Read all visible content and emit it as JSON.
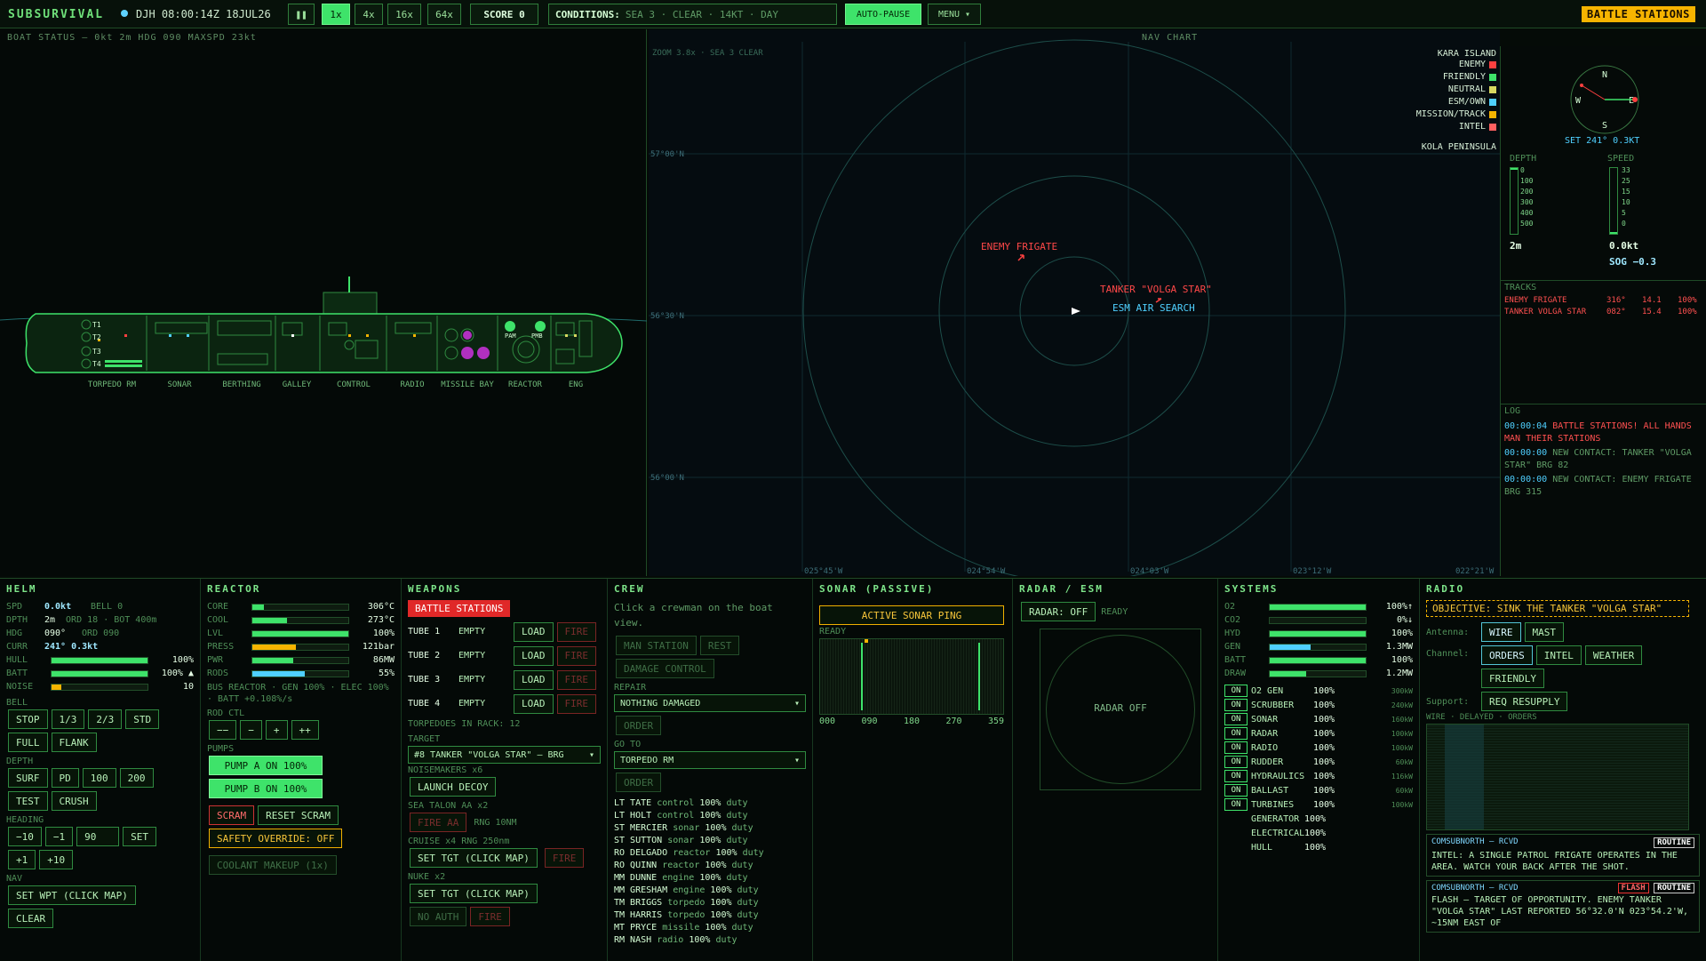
{
  "top": {
    "brand": "SUBSURVIVAL",
    "clock": "DJH 08:00:14Z 18JUL26",
    "pause": "❚❚",
    "speeds": [
      "1x",
      "4x",
      "16x",
      "64x"
    ],
    "score_label": "SCORE",
    "score": "0",
    "cond_label": "CONDITIONS:",
    "cond": "SEA 3 · CLEAR · 14KT · DAY",
    "autopause": "AUTO-PAUSE",
    "menu": "MENU ▾",
    "battle": "BATTLE STATIONS"
  },
  "boat": {
    "title": "BOAT STATUS — 0kt 2m HDG 090 MAXSPD 23kt",
    "compartments": [
      "TORPEDO RM",
      "SONAR",
      "BERTHING",
      "GALLEY",
      "CONTROL",
      "RADIO",
      "MISSILE BAY",
      "REACTOR",
      "ENG"
    ],
    "tubes": [
      "T1",
      "T2",
      "T3",
      "T4"
    ],
    "pam": "PAM",
    "pmb": "PMB"
  },
  "nav": {
    "title": "NAV CHART",
    "sub": "ZOOM 3.8x · SEA 3 CLEAR",
    "lat": [
      "57°00'N",
      "56°30'N",
      "56°00'N"
    ],
    "lon": [
      "025°45'W",
      "024°54'W",
      "024°03'W",
      "023°12'W",
      "022°21'W"
    ],
    "kara": "KARA ISLAND",
    "kola": "KOLA PENINSULA",
    "legend": [
      {
        "t": "ENEMY",
        "c": "#ff4040"
      },
      {
        "t": "FRIENDLY",
        "c": "#3ee36a"
      },
      {
        "t": "NEUTRAL",
        "c": "#d8d860"
      },
      {
        "t": "ESM/OWN",
        "c": "#4fd0ff"
      },
      {
        "t": "MISSION/TRACK",
        "c": "#f6b400"
      },
      {
        "t": "INTEL",
        "c": "#ff6060"
      }
    ],
    "contacts": {
      "frigate": "ENEMY FRIGATE",
      "tanker": "TANKER \"VOLGA STAR\"",
      "esm": "ESM AIR SEARCH"
    }
  },
  "side": {
    "set": "SET 241° 0.3KT",
    "compass": [
      "N",
      "S",
      "W",
      "E"
    ],
    "depth_label": "DEPTH",
    "speed_label": "SPEED",
    "depth_ticks": [
      "0",
      "100",
      "200",
      "300",
      "400",
      "500"
    ],
    "speed_ticks": [
      "33",
      "25",
      "15",
      "10",
      "5",
      "0"
    ],
    "depth_val": "2m",
    "speed_val": "0.0kt",
    "sog": "SOG −0.3",
    "tracks_label": "TRACKS",
    "tracks": [
      {
        "n": "ENEMY FRIGATE",
        "b": "316°",
        "r": "14.1",
        "p": "100%"
      },
      {
        "n": "TANKER VOLGA STAR",
        "b": "082°",
        "r": "15.4",
        "p": "100%"
      }
    ],
    "log_label": "LOG",
    "log": [
      {
        "t": "00:00:04",
        "m": "BATTLE STATIONS! ALL HANDS MAN THEIR STATIONS",
        "red": true
      },
      {
        "t": "00:00:00",
        "m": "NEW CONTACT: TANKER \"VOLGA STAR\" BRG 82",
        "red": false
      },
      {
        "t": "00:00:00",
        "m": "NEW CONTACT: ENEMY FRIGATE BRG 315",
        "red": false
      }
    ]
  },
  "helm": {
    "title": "HELM",
    "spd_l": "SPD",
    "spd": "0.0kt",
    "bell": "BELL 0",
    "dpth_l": "DPTH",
    "dpth": "2m",
    "ord": "ORD 18",
    "bot": "· BOT 400m",
    "hdg_l": "HDG",
    "hdg": "090°",
    "ordh": "ORD 090",
    "curr_l": "CURR",
    "curr": "241° 0.3kt",
    "hull_l": "HULL",
    "hull": "100%",
    "hull_v": 1.0,
    "batt_l": "BATT",
    "batt": "100% ▲",
    "batt_v": 1.0,
    "noise_l": "NOISE",
    "noise": "10",
    "noise_v": 0.1,
    "bell_l": "BELL",
    "bells": [
      "STOP",
      "1/3",
      "2/3",
      "STD",
      "FULL",
      "FLANK"
    ],
    "depth_l": "DEPTH",
    "depths": [
      "SURF",
      "PD",
      "100",
      "200",
      "TEST",
      "CRUSH"
    ],
    "heading_l": "HEADING",
    "head1": [
      "−10",
      "−1"
    ],
    "head_in": "90",
    "set": "SET",
    "head2": [
      "+1",
      "+10"
    ],
    "nav_l": "NAV",
    "wpt": "SET WPT (CLICK MAP)",
    "clear": "CLEAR"
  },
  "reactor": {
    "title": "REACTOR",
    "rows": [
      {
        "l": "CORE",
        "v": "306°C",
        "f": 0.12,
        "c": "#3ee36a"
      },
      {
        "l": "COOL",
        "v": "273°C",
        "f": 0.36,
        "c": "#3ee36a"
      },
      {
        "l": "LVL",
        "v": "100%",
        "f": 1.0,
        "c": "#3ee36a"
      },
      {
        "l": "PRESS",
        "v": "121bar",
        "f": 0.45,
        "c": "#f6b400"
      },
      {
        "l": "PWR",
        "v": "86MW",
        "f": 0.43,
        "c": "#3ee36a"
      },
      {
        "l": "RODS",
        "v": "55%",
        "f": 0.55,
        "c": "#4fd0ff"
      }
    ],
    "bus": "BUS REACTOR · GEN 100% · ELEC 100% · BATT +0.108%/s",
    "rod_l": "ROD CTL",
    "rods": [
      "−−",
      "−",
      "+",
      "++"
    ],
    "pumps_l": "PUMPS",
    "pumpA": "PUMP A ON 100%",
    "pumpB": "PUMP B ON 100%",
    "scram": "SCRAM",
    "reset": "RESET SCRAM",
    "override": "SAFETY OVERRIDE: OFF",
    "coolant": "COOLANT MAKEUP (1x)"
  },
  "weapons": {
    "title": "WEAPONS",
    "battle": "BATTLE STATIONS",
    "tubes": [
      {
        "n": "TUBE 1",
        "s": "EMPTY"
      },
      {
        "n": "TUBE 2",
        "s": "EMPTY"
      },
      {
        "n": "TUBE 3",
        "s": "EMPTY"
      },
      {
        "n": "TUBE 4",
        "s": "EMPTY"
      }
    ],
    "load": "LOAD",
    "fire": "FIRE",
    "rack": "TORPEDOES IN RACK: 12",
    "target_l": "TARGET",
    "target": "#8 TANKER \"VOLGA STAR\" — BRG",
    "noise_l": "NOISEMAKERS x6",
    "decoy": "LAUNCH DECOY",
    "sam_l": "SEA TALON AA x2",
    "fireaa": "FIRE AA",
    "rng": "RNG 10NM",
    "cruise_l": "CRUISE x4 RNG 250nm",
    "settgt": "SET TGT (CLICK MAP)",
    "nuke_l": "NUKE x2",
    "noauth": "NO AUTH"
  },
  "crew": {
    "title": "CREW",
    "hint": "Click a crewman on the boat view.",
    "man": "MAN STATION",
    "rest": "REST",
    "dc": "DAMAGE CONTROL",
    "repair_l": "REPAIR",
    "repair": "NOTHING DAMAGED",
    "order": "ORDER",
    "goto_l": "GO TO",
    "goto": "TORPEDO RM",
    "list": [
      [
        "LT TATE",
        "control",
        "100%",
        "duty"
      ],
      [
        "LT HOLT",
        "control",
        "100%",
        "duty"
      ],
      [
        "ST MERCIER",
        "sonar",
        "100%",
        "duty"
      ],
      [
        "ST SUTTON",
        "sonar",
        "100%",
        "duty"
      ],
      [
        "RO DELGADO",
        "reactor",
        "100%",
        "duty"
      ],
      [
        "RO QUINN",
        "reactor",
        "100%",
        "duty"
      ],
      [
        "MM DUNNE",
        "engine",
        "100%",
        "duty"
      ],
      [
        "MM GRESHAM",
        "engine",
        "100%",
        "duty"
      ],
      [
        "TM BRIGGS",
        "torpedo",
        "100%",
        "duty"
      ],
      [
        "TM HARRIS",
        "torpedo",
        "100%",
        "duty"
      ],
      [
        "MT PRYCE",
        "missile",
        "100%",
        "duty"
      ],
      [
        "RM NASH",
        "radio",
        "100%",
        "duty"
      ]
    ]
  },
  "sonar": {
    "title": "SONAR (PASSIVE)",
    "ping": "ACTIVE SONAR PING",
    "ready": "READY",
    "ticks": [
      "000",
      "090",
      "180",
      "270",
      "359"
    ]
  },
  "radar": {
    "title": "RADAR / ESM",
    "btn": "RADAR: OFF",
    "ready": "READY",
    "off": "RADAR OFF"
  },
  "systems": {
    "title": "SYSTEMS",
    "bars": [
      {
        "l": "O2",
        "v": "100%↑",
        "f": 1.0,
        "c": "#3ee36a"
      },
      {
        "l": "CO2",
        "v": "0%↓",
        "f": 0.0,
        "c": "#3ee36a"
      },
      {
        "l": "HYD",
        "v": "100%",
        "f": 1.0,
        "c": "#3ee36a"
      },
      {
        "l": "GEN",
        "v": "1.3MW",
        "f": 0.43,
        "c": "#4fd0ff"
      },
      {
        "l": "BATT",
        "v": "100%",
        "f": 1.0,
        "c": "#3ee36a"
      },
      {
        "l": "DRAW",
        "v": "1.2MW",
        "f": 0.38,
        "c": "#3ee36a"
      }
    ],
    "list": [
      {
        "n": "O2 GEN",
        "p": "100%",
        "w": "300kW",
        "on": true
      },
      {
        "n": "SCRUBBER",
        "p": "100%",
        "w": "240kW",
        "on": true
      },
      {
        "n": "SONAR",
        "p": "100%",
        "w": "160kW",
        "on": true
      },
      {
        "n": "RADAR",
        "p": "100%",
        "w": "100kW",
        "on": true
      },
      {
        "n": "RADIO",
        "p": "100%",
        "w": "100kW",
        "on": true
      },
      {
        "n": "RUDDER",
        "p": "100%",
        "w": "60kW",
        "on": true
      },
      {
        "n": "HYDRAULICS",
        "p": "100%",
        "w": "116kW",
        "on": true
      },
      {
        "n": "BALLAST",
        "p": "100%",
        "w": "60kW",
        "on": true
      },
      {
        "n": "TURBINES",
        "p": "100%",
        "w": "100kW",
        "on": true
      },
      {
        "n": "GENERATOR",
        "p": "100%",
        "w": "",
        "on": false
      },
      {
        "n": "ELECTRICAL",
        "p": "100%",
        "w": "",
        "on": false
      },
      {
        "n": "HULL",
        "p": "100%",
        "w": "",
        "on": false
      }
    ],
    "on": "ON"
  },
  "radio": {
    "title": "RADIO",
    "objective": "OBJECTIVE: SINK THE TANKER \"VOLGA STAR\"",
    "antenna_l": "Antenna:",
    "wire": "WIRE",
    "mast": "MAST",
    "channel_l": "Channel:",
    "channels": [
      "ORDERS",
      "INTEL",
      "WEATHER",
      "FRIENDLY"
    ],
    "support_l": "Support:",
    "resupply": "REQ RESUPPLY",
    "wire_note": "WIRE · DELAYED · ORDERS",
    "msgs": [
      {
        "from": "COMSUBNORTH — RCVD",
        "flash": "",
        "tag": "ROUTINE",
        "body": "INTEL: A SINGLE PATROL FRIGATE OPERATES IN THE AREA. WATCH YOUR BACK AFTER THE SHOT."
      },
      {
        "from": "COMSUBNORTH — RCVD",
        "flash": "FLASH",
        "tag": "ROUTINE",
        "body": "FLASH — TARGET OF OPPORTUNITY. ENEMY TANKER \"VOLGA STAR\" LAST REPORTED 56°32.0'N 023°54.2'W, ~15NM EAST OF"
      }
    ]
  }
}
